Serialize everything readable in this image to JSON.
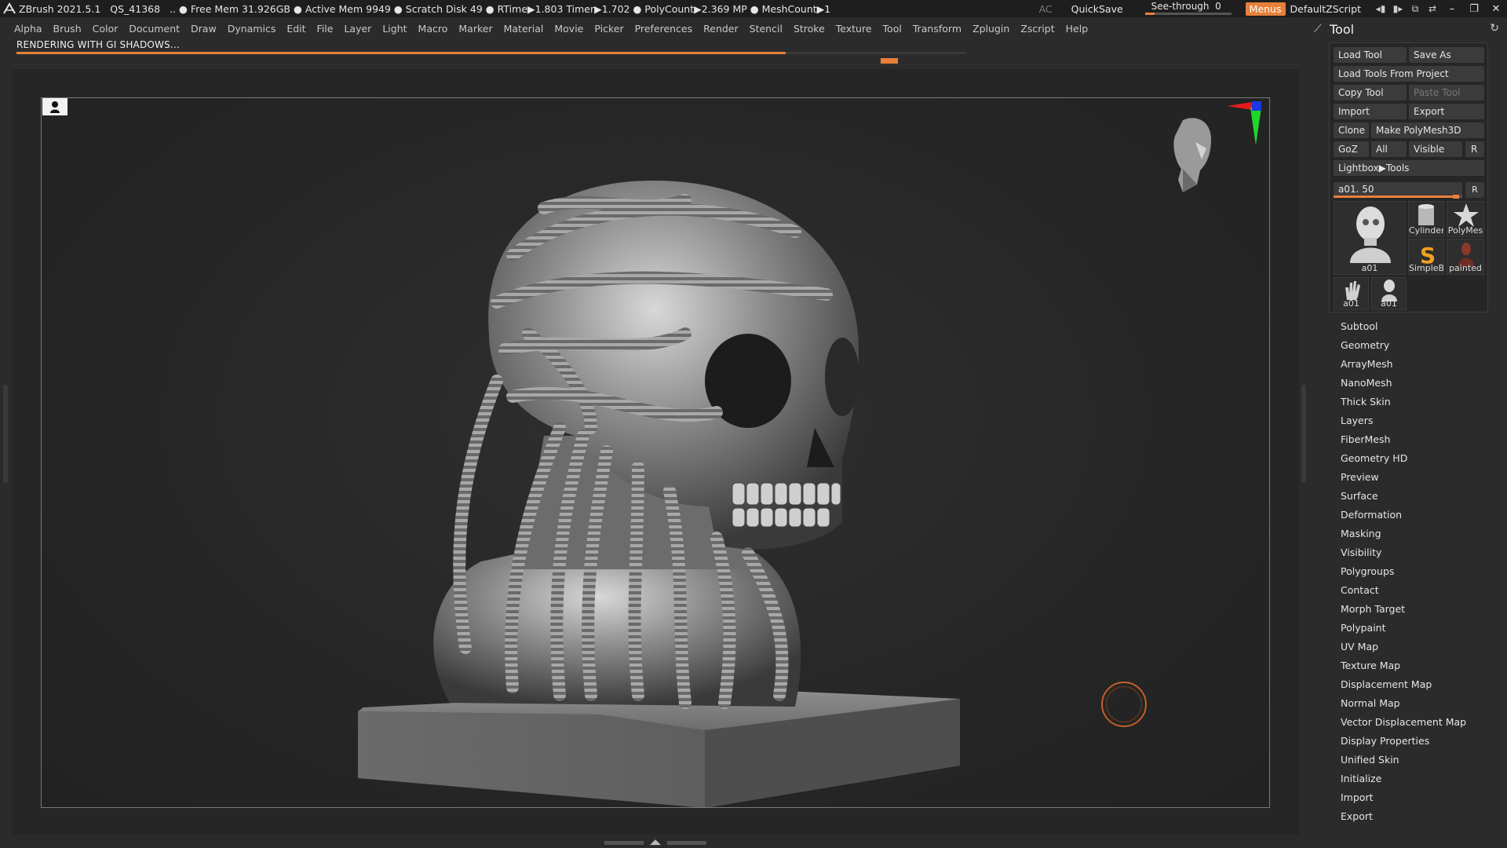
{
  "titlebar": {
    "app": "ZBrush 2021.5.1",
    "project": "QS_41368",
    "stats": ".. ● Free Mem 31.926GB ● Active Mem 9949 ● Scratch Disk 49 ● RTime▶1.803 Timer▶1.702 ● PolyCount▶2.369 MP ● MeshCount▶1",
    "ac": "AC",
    "quicksave": "QuickSave",
    "see_through_label": "See-through",
    "see_through_value": "0",
    "see_through_fraction": 0.0,
    "menus": "Menus",
    "default_zscript": "DefaultZScript"
  },
  "menubar": [
    "Alpha",
    "Brush",
    "Color",
    "Document",
    "Draw",
    "Dynamics",
    "Edit",
    "File",
    "Layer",
    "Light",
    "Macro",
    "Marker",
    "Material",
    "Movie",
    "Picker",
    "Preferences",
    "Render",
    "Stencil",
    "Stroke",
    "Texture",
    "Tool",
    "Transform",
    "Zplugin",
    "Zscript",
    "Help"
  ],
  "render": {
    "status": "RENDERING WITH GI SHADOWS...",
    "progress": 0.81
  },
  "colors": {
    "accent": "#e8803a",
    "bg": "#2b2b2b",
    "canvas_border": "#7a7a7a",
    "axis_x": "#e21b1b",
    "axis_y": "#1fd62a",
    "axis_z": "#1b38e2"
  },
  "tool_panel": {
    "title": "Tool",
    "buttons": {
      "load_tool": "Load Tool",
      "save_as": "Save As",
      "load_tools_from_project": "Load Tools From Project",
      "copy_tool": "Copy Tool",
      "paste_tool": "Paste Tool",
      "import": "Import",
      "export": "Export",
      "clone": "Clone",
      "make_polymesh3d": "Make PolyMesh3D",
      "goz": "GoZ",
      "all": "All",
      "visible": "Visible",
      "r": "R",
      "lightbox_tools": "Lightbox▶Tools"
    },
    "slider": {
      "label": "a01. 50",
      "r": "R"
    },
    "thumbnails": {
      "main": "a01",
      "cylinder": "Cylinder",
      "polymesh": "PolyMes",
      "simpleb": "SimpleB",
      "painted": "painted",
      "small1": "a01",
      "small2": "a01"
    },
    "subpalettes": [
      "Subtool",
      "Geometry",
      "ArrayMesh",
      "NanoMesh",
      "Thick Skin",
      "Layers",
      "FiberMesh",
      "Geometry HD",
      "Preview",
      "Surface",
      "Deformation",
      "Masking",
      "Visibility",
      "Polygroups",
      "Contact",
      "Morph Target",
      "Polypaint",
      "UV Map",
      "Texture Map",
      "Displacement Map",
      "Normal Map",
      "Vector Displacement Map",
      "Display Properties",
      "Unified Skin",
      "Initialize",
      "Import",
      "Export"
    ]
  },
  "icons": {
    "app_logo": "zbrush-logo-icon",
    "camera": "camera-view-icon",
    "axis": "axis-gizmo-icon",
    "head": "navigation-head-icon",
    "brush": "brush-cursor-icon",
    "pin": "pin-icon",
    "refresh": "refresh-icon"
  }
}
